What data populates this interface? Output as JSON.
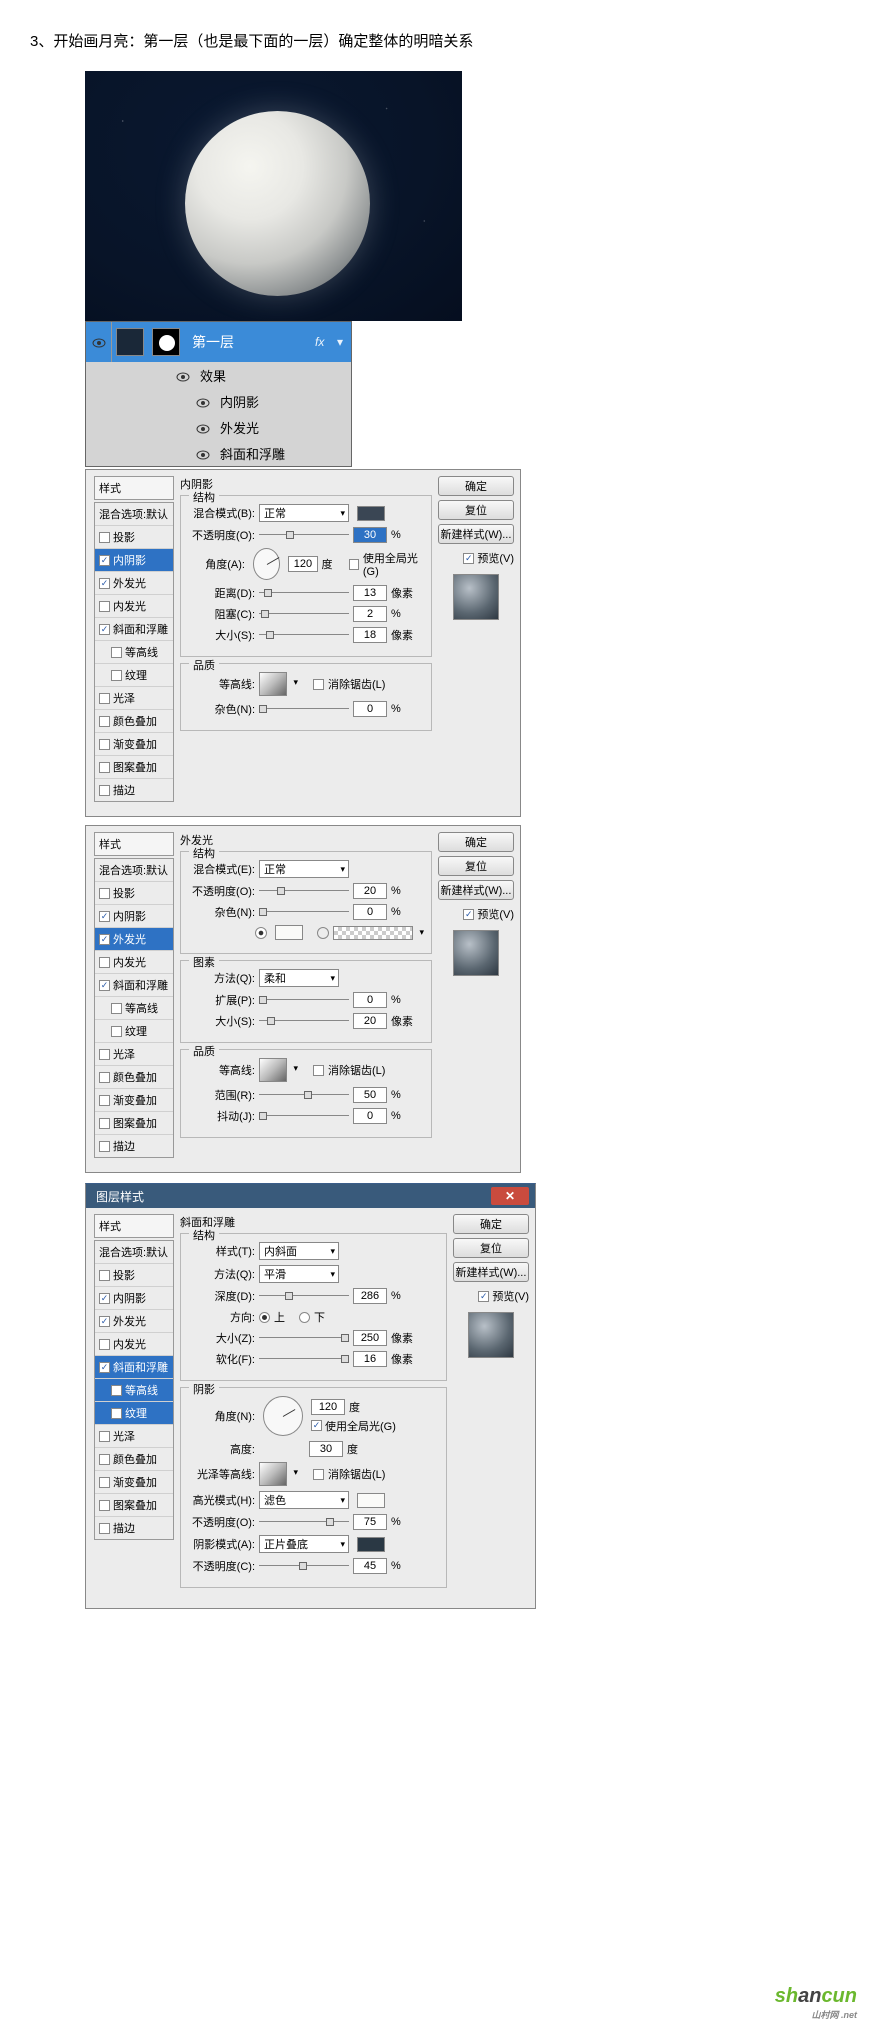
{
  "heading": "3、开始画月亮：第一层（也是最下面的一层）确定整体的明暗关系",
  "layers_panel": {
    "layer_name": "第一层",
    "fx_label": "fx",
    "effects_label": "效果",
    "effects": [
      "内阴影",
      "外发光",
      "斜面和浮雕"
    ]
  },
  "style_labels": {
    "header": "样式",
    "blend_default": "混合选项:默认",
    "drop_shadow": "投影",
    "inner_shadow": "内阴影",
    "outer_glow": "外发光",
    "inner_glow": "内发光",
    "bevel": "斜面和浮雕",
    "contour_sub": "等高线",
    "texture_sub": "纹理",
    "satin": "光泽",
    "color_overlay": "颜色叠加",
    "grad_overlay": "渐变叠加",
    "pattern_overlay": "图案叠加",
    "stroke": "描边"
  },
  "buttons": {
    "ok": "确定",
    "cancel": "复位",
    "new_style": "新建样式(W)...",
    "preview": "预览(V)"
  },
  "panel1": {
    "title": "内阴影",
    "structure": "结构",
    "blend_mode_label": "混合模式(B):",
    "blend_mode_value": "正常",
    "opacity_label": "不透明度(O):",
    "opacity_value": "30",
    "angle_label": "角度(A):",
    "angle_value": "120",
    "angle_unit": "度",
    "global_light": "使用全局光(G)",
    "distance_label": "距离(D):",
    "distance_value": "13",
    "distance_unit": "像素",
    "choke_label": "阻塞(C):",
    "choke_value": "2",
    "choke_unit": "%",
    "size_label": "大小(S):",
    "size_value": "18",
    "size_unit": "像素",
    "quality": "品质",
    "contour_label": "等高线:",
    "anti_alias": "消除锯齿(L)",
    "noise_label": "杂色(N):",
    "noise_value": "0",
    "noise_unit": "%"
  },
  "panel2": {
    "title": "外发光",
    "structure": "结构",
    "blend_mode_label": "混合模式(E):",
    "blend_mode_value": "正常",
    "opacity_label": "不透明度(O):",
    "opacity_value": "20",
    "noise_label": "杂色(N):",
    "noise_value": "0",
    "elements": "图素",
    "technique_label": "方法(Q):",
    "technique_value": "柔和",
    "spread_label": "扩展(P):",
    "spread_value": "0",
    "size_label": "大小(S):",
    "size_value": "20",
    "size_unit": "像素",
    "quality": "品质",
    "contour_label": "等高线:",
    "anti_alias": "消除锯齿(L)",
    "range_label": "范围(R):",
    "range_value": "50",
    "jitter_label": "抖动(J):",
    "jitter_value": "0",
    "percent": "%"
  },
  "panel3": {
    "dialog_title": "图层样式",
    "title": "斜面和浮雕",
    "structure": "结构",
    "style_label": "样式(T):",
    "style_value": "内斜面",
    "technique_label": "方法(Q):",
    "technique_value": "平滑",
    "depth_label": "深度(D):",
    "depth_value": "286",
    "direction_label": "方向:",
    "dir_up": "上",
    "dir_down": "下",
    "size_label": "大小(Z):",
    "size_value": "250",
    "size_unit": "像素",
    "soften_label": "软化(F):",
    "soften_value": "16",
    "soften_unit": "像素",
    "shading": "阴影",
    "angle_label": "角度(N):",
    "angle_value": "120",
    "angle_unit": "度",
    "global_light": "使用全局光(G)",
    "altitude_label": "高度:",
    "altitude_value": "30",
    "altitude_unit": "度",
    "gloss_label": "光泽等高线:",
    "anti_alias": "消除锯齿(L)",
    "highlight_mode_label": "高光模式(H):",
    "highlight_mode_value": "滤色",
    "hl_opacity_label": "不透明度(O):",
    "hl_opacity_value": "75",
    "shadow_mode_label": "阴影模式(A):",
    "shadow_mode_value": "正片叠底",
    "sh_opacity_label": "不透明度(C):",
    "sh_opacity_value": "45",
    "percent": "%"
  },
  "watermark": {
    "text1": "s",
    "text2": "h",
    "text3": "an",
    "text4": "cun",
    "sub": "山村网 .net"
  }
}
